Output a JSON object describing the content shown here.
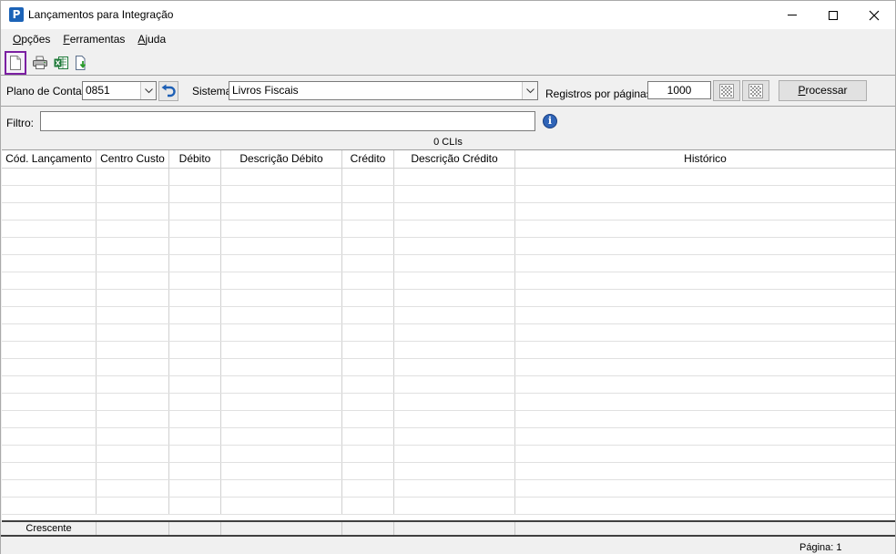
{
  "window": {
    "title": "Lançamentos para Integração",
    "icon_letter": "P"
  },
  "menu": {
    "items": [
      {
        "label_ul": "O",
        "label_rest": "pções"
      },
      {
        "label_ul": "F",
        "label_rest": "erramentas"
      },
      {
        "label_ul": "A",
        "label_rest": "juda"
      }
    ]
  },
  "toolbar": {
    "icons": [
      "new-document-icon",
      "printer-icon",
      "excel-icon",
      "export-icon"
    ]
  },
  "params": {
    "plano_label": "Plano de Contas",
    "plano_value": "0851",
    "sistema_label": "Sistema",
    "sistema_value": "Livros Fiscais",
    "registros_label": "Registros por páginas:",
    "registros_value": "1000",
    "processar_ul": "P",
    "processar_rest": "rocessar"
  },
  "filter": {
    "label": "Filtro:",
    "value": ""
  },
  "count": "0 CLIs",
  "grid": {
    "columns": [
      "Cód. Lançamento",
      "Centro Custo",
      "Débito",
      "Descrição Débito",
      "Crédito",
      "Descrição Crédito",
      "Histórico"
    ]
  },
  "sort": {
    "first": "Crescente"
  },
  "status": {
    "page": "Página: 1"
  }
}
